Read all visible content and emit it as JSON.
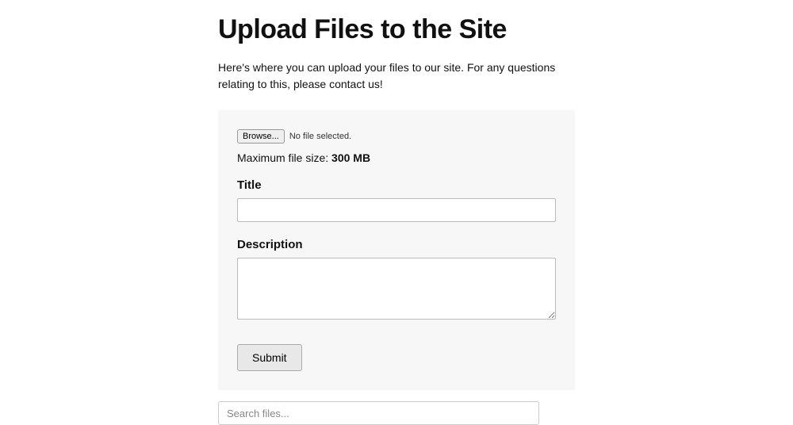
{
  "page": {
    "title": "Upload Files to the Site",
    "intro": "Here's where you can upload your files to our site. For any questions relating to this, please contact us!"
  },
  "form": {
    "file": {
      "browse_label": "Browse...",
      "status": "No file selected.",
      "maxsize_label": "Maximum file size: ",
      "maxsize_value": "300 MB"
    },
    "title": {
      "label": "Title",
      "value": ""
    },
    "description": {
      "label": "Description",
      "value": ""
    },
    "submit_label": "Submit"
  },
  "search": {
    "placeholder": "Search files...",
    "value": ""
  }
}
